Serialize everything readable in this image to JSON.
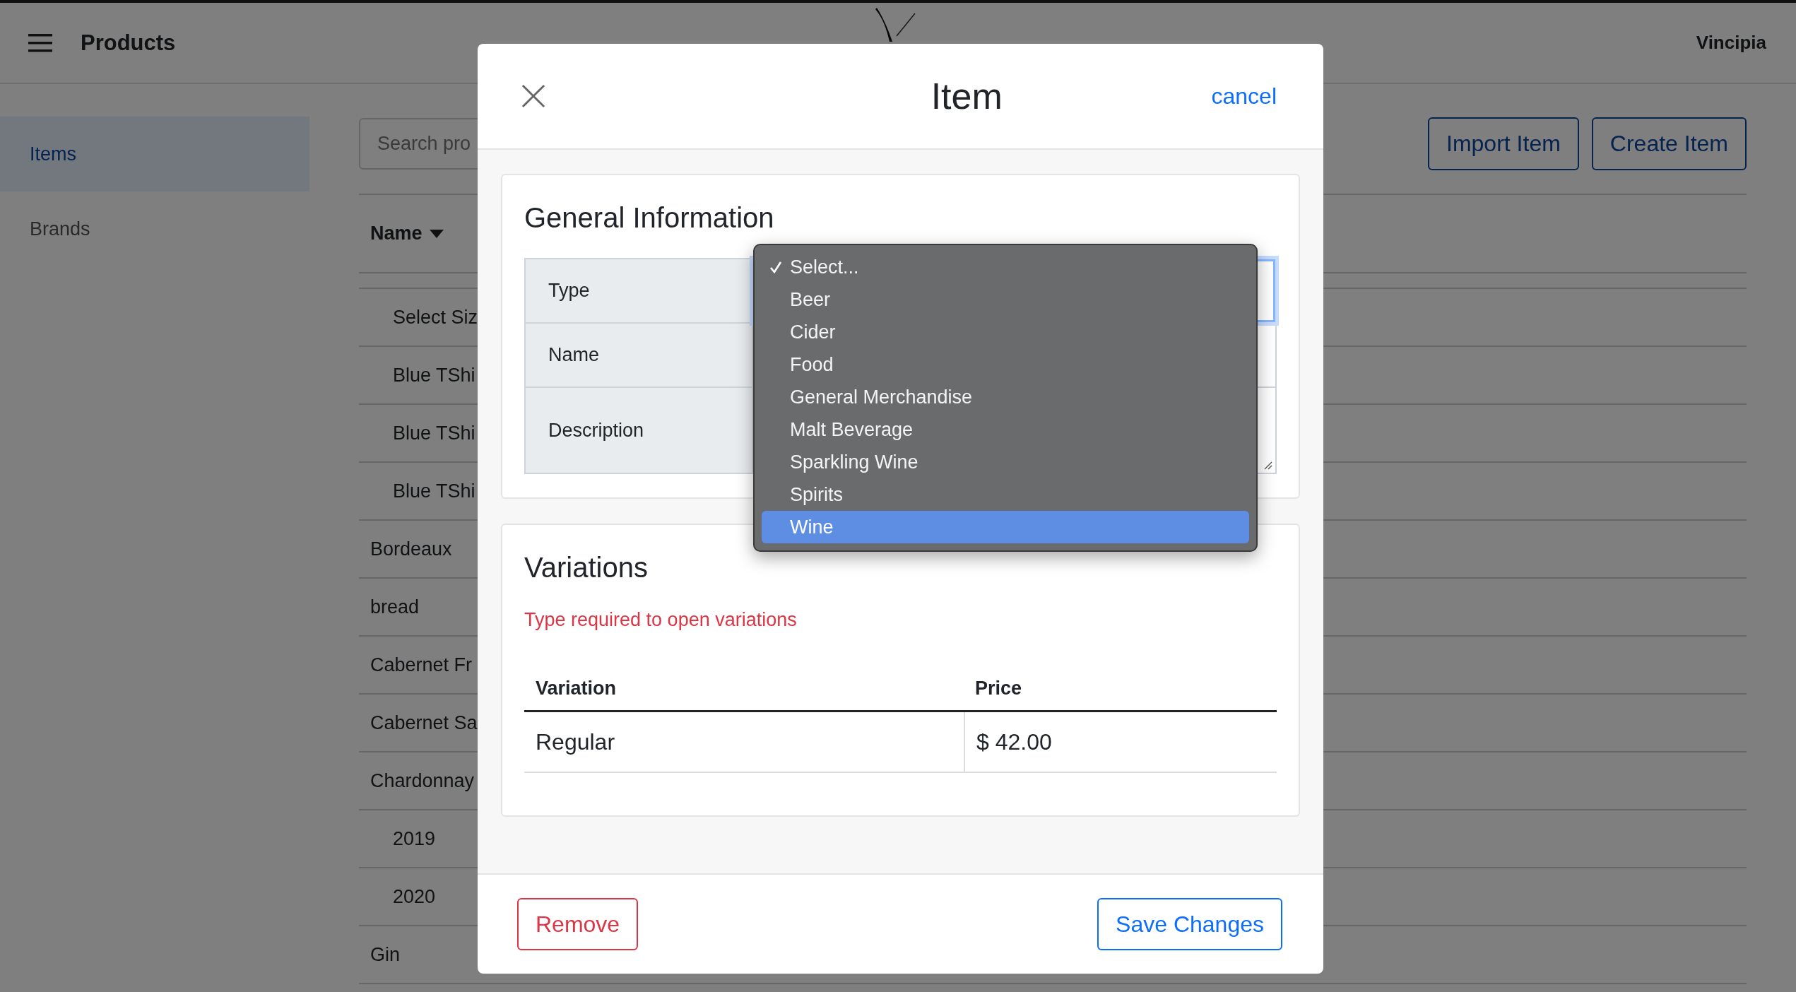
{
  "app_bar": {
    "title": "Products",
    "account": "Vincipia"
  },
  "sidebar": {
    "items": [
      {
        "label": "Items",
        "selected": true
      },
      {
        "label": "Brands",
        "selected": false
      }
    ]
  },
  "search": {
    "placeholder": "Search pro"
  },
  "actions": [
    "Import Item",
    "Create Item"
  ],
  "table": {
    "column_header": "Name",
    "rows": [
      {
        "children": [
          {
            "name": "Select Siz"
          },
          {
            "name": "Blue TShi"
          },
          {
            "name": "Blue TShi"
          },
          {
            "name": "Blue TShi"
          }
        ]
      },
      {
        "name": "Bordeaux"
      },
      {
        "name": "bread"
      },
      {
        "name": "Cabernet Fr"
      },
      {
        "name": "Cabernet Sa"
      },
      {
        "name": "Chardonnay",
        "children": [
          {
            "name": "2019"
          },
          {
            "name": "2020"
          }
        ]
      },
      {
        "name": "Gin"
      }
    ]
  },
  "modal": {
    "title": "Item",
    "cancel": "cancel",
    "general": {
      "heading": "General Information",
      "fields": [
        {
          "label": "Type",
          "kind": "select"
        },
        {
          "label": "Name",
          "kind": "text"
        },
        {
          "label": "Description",
          "kind": "textarea"
        }
      ]
    },
    "type_menu": {
      "options": [
        {
          "label": "Select...",
          "checked": true,
          "highlighted": false
        },
        {
          "label": "Beer",
          "checked": false,
          "highlighted": false
        },
        {
          "label": "Cider",
          "checked": false,
          "highlighted": false
        },
        {
          "label": "Food",
          "checked": false,
          "highlighted": false
        },
        {
          "label": "General Merchandise",
          "checked": false,
          "highlighted": false
        },
        {
          "label": "Malt Beverage",
          "checked": false,
          "highlighted": false
        },
        {
          "label": "Sparkling Wine",
          "checked": false,
          "highlighted": false
        },
        {
          "label": "Spirits",
          "checked": false,
          "highlighted": false
        },
        {
          "label": "Wine",
          "checked": false,
          "highlighted": true
        }
      ]
    },
    "variations": {
      "heading": "Variations",
      "error": "Type required to open variations",
      "columns": [
        "Variation",
        "Price"
      ],
      "rows": [
        {
          "variation": "Regular",
          "price": "$ 42.00"
        }
      ]
    },
    "footer": {
      "remove": "Remove",
      "save": "Save Changes"
    }
  }
}
